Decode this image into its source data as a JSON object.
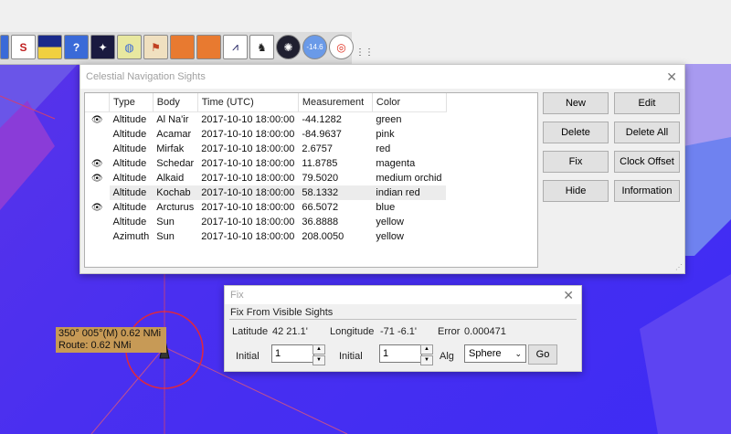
{
  "toolbar": {
    "icons": [
      "route-icon",
      "chart-icon",
      "help-icon",
      "sky-icon",
      "stars-icon",
      "cursor-icon",
      "folder-icon",
      "folder2-icon",
      "sights-icon",
      "dog-icon",
      "compass-icon",
      "gauge-icon",
      "lifebuoy-icon"
    ],
    "gauge_text": "-14.6",
    "more": "⋮⋮"
  },
  "sights_window": {
    "title": "Celestial Navigation Sights",
    "columns": [
      "Type",
      "Body",
      "Time (UTC)",
      "Measurement",
      "Color"
    ],
    "rows": [
      {
        "visible": true,
        "type": "Altitude",
        "body": "Al Na'ir",
        "time": "2017-10-10 18:00:00",
        "measurement": "-44.1282",
        "color": "green"
      },
      {
        "visible": false,
        "type": "Altitude",
        "body": "Acamar",
        "time": "2017-10-10 18:00:00",
        "measurement": "-84.9637",
        "color": "pink"
      },
      {
        "visible": false,
        "type": "Altitude",
        "body": "Mirfak",
        "time": "2017-10-10 18:00:00",
        "measurement": "2.6757",
        "color": "red"
      },
      {
        "visible": true,
        "type": "Altitude",
        "body": "Schedar",
        "time": "2017-10-10 18:00:00",
        "measurement": "11.8785",
        "color": "magenta"
      },
      {
        "visible": true,
        "type": "Altitude",
        "body": "Alkaid",
        "time": "2017-10-10 18:00:00",
        "measurement": "79.5020",
        "color": "medium orchid"
      },
      {
        "visible": false,
        "type": "Altitude",
        "body": "Kochab",
        "time": "2017-10-10 18:00:00",
        "measurement": "58.1332",
        "color": "indian red"
      },
      {
        "visible": true,
        "type": "Altitude",
        "body": "Arcturus",
        "time": "2017-10-10 18:00:00",
        "measurement": "66.5072",
        "color": "blue"
      },
      {
        "visible": false,
        "type": "Altitude",
        "body": "Sun",
        "time": "2017-10-10 18:00:00",
        "measurement": "36.8888",
        "color": "yellow"
      },
      {
        "visible": false,
        "type": "Azimuth",
        "body": "Sun",
        "time": "2017-10-10 18:00:00",
        "measurement": "208.0050",
        "color": "yellow"
      }
    ],
    "buttons": {
      "new": "New",
      "edit": "Edit",
      "delete": "Delete",
      "delete_all": "Delete All",
      "fix": "Fix",
      "clock_offset": "Clock Offset",
      "hide": "Hide",
      "information": "Information"
    },
    "close": "✕"
  },
  "fix_window": {
    "title": "Fix",
    "header": "Fix From Visible Sights",
    "latitude_label": "Latitude",
    "latitude_value": "42 21.1'",
    "longitude_label": "Longitude",
    "longitude_value": "-71 -6.1'",
    "error_label": "Error",
    "error_value": "0.000471",
    "initial_label": "Initial",
    "initial_lat": "1",
    "initial_lon": "1",
    "alg_label": "Alg",
    "alg_value": "Sphere",
    "go_label": "Go",
    "close": "✕"
  },
  "route_box": {
    "line1": "350°  005°(M)   0.62 NMi",
    "line2": "Route: 0.62 NMi"
  },
  "colors": {
    "sea": "#4a30ef",
    "land_green": "#5aa03c",
    "label_bg": "#c79a56",
    "range_ring": "#e0283c"
  }
}
